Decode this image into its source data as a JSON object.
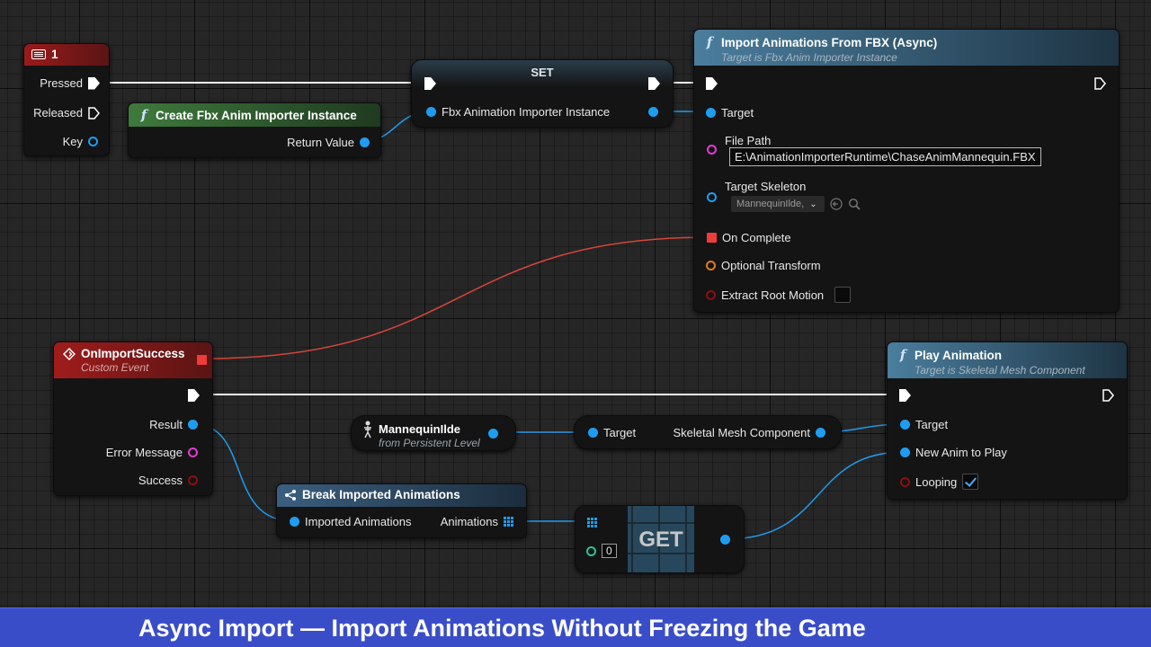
{
  "key_event": {
    "title": "1",
    "pins": {
      "pressed": "Pressed",
      "released": "Released",
      "key": "Key"
    }
  },
  "create_importer": {
    "title": "Create Fbx Anim Importer Instance",
    "return_value": "Return Value"
  },
  "set_node": {
    "title": "SET",
    "var": "Fbx Animation Importer Instance"
  },
  "import_async": {
    "title": "Import Animations From FBX (Async)",
    "subtitle": "Target is Fbx Anim Importer Instance",
    "target": "Target",
    "file_path_label": "File Path",
    "file_path_value": "E:\\AnimationImporterRuntime\\ChaseAnimMannequin.FBX",
    "target_skeleton_label": "Target Skeleton",
    "target_skeleton_value": "MannequinIlde,",
    "on_complete": "On Complete",
    "optional_transform": "Optional Transform",
    "extract_root_motion": "Extract Root Motion"
  },
  "on_import_success": {
    "title": "OnImportSuccess",
    "subtitle": "Custom Event",
    "result": "Result",
    "error_message": "Error Message",
    "success": "Success"
  },
  "mannequin_ref": {
    "title": "MannequinIlde",
    "subtitle": "from Persistent Level"
  },
  "skeletal_mesh": {
    "target": "Target",
    "output": "Skeletal Mesh Component"
  },
  "play_animation": {
    "title": "Play Animation",
    "subtitle": "Target is Skeletal Mesh Component",
    "target": "Target",
    "new_anim": "New Anim to Play",
    "looping": "Looping"
  },
  "break_imported": {
    "title": "Break Imported Animations",
    "input": "Imported Animations",
    "output": "Animations"
  },
  "get_node": {
    "label": "GET",
    "index": "0"
  },
  "banner": {
    "text": "Async Import — Import Animations Without Freezing the Game"
  },
  "colors": {
    "exec": "#ffffff",
    "object": "#1e9df0",
    "string": "#e33bd4",
    "delegate": "#ef3b3b",
    "struct": "#e07a1f",
    "bool": "#8b0f13",
    "int": "#22c79a",
    "banner": "#3a4dc9"
  }
}
